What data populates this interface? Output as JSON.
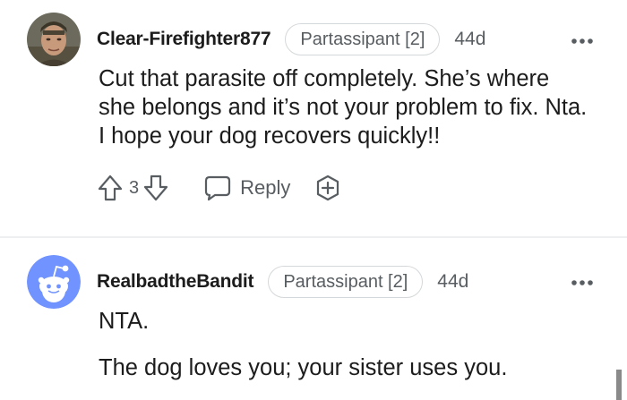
{
  "comments": [
    {
      "username": "Clear-Firefighter877",
      "flair": "Partassipant [2]",
      "age": "44d",
      "body": [
        "Cut that parasite off completely. She’s where she belongs and it’s not your problem to fix. Nta. I hope your dog recovers quickly!!"
      ],
      "votes": "3",
      "reply_label": "Reply",
      "avatar_icon": "user-photo-avatar"
    },
    {
      "username": "RealbadtheBandit",
      "flair": "Partassipant [2]",
      "age": "44d",
      "body": [
        "NTA.",
        "The dog loves you; your sister uses you."
      ],
      "avatar_icon": "snoo-avatar"
    }
  ],
  "icons": {
    "upvote": "arrow-up-icon",
    "downvote": "arrow-down-icon",
    "reply": "speech-bubble-icon",
    "award": "award-plus-icon",
    "more": "more-dots-icon"
  },
  "colors": {
    "text": "#1c1c1c",
    "meta": "#585d61",
    "border": "#d5d8da",
    "snoo_bg": "#7193ff"
  }
}
